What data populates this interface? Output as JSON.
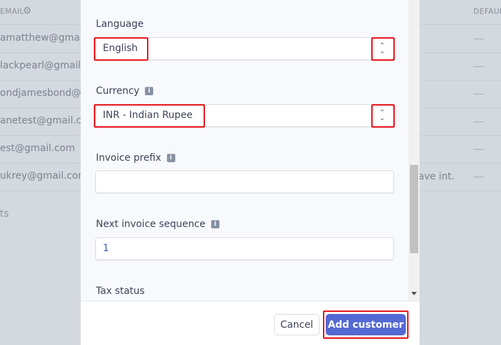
{
  "background": {
    "email_header": "EMAIL",
    "default_header": "DEFAULT",
    "emails": [
      "amatthew@gmail.com",
      "lackpearl@gmail.com",
      "ondjamesbond@gmail.com",
      "anetest@gmail.com",
      "est@gmail.com",
      "ukrey@gmail.com"
    ],
    "row6_extra": "ave int.",
    "dash": "—",
    "footer_text": "ts"
  },
  "modal": {
    "language": {
      "label": "Language",
      "value": "English"
    },
    "currency": {
      "label": "Currency",
      "value": "INR - Indian Rupee"
    },
    "invoice_prefix": {
      "label": "Invoice prefix",
      "value": ""
    },
    "next_invoice_sequence": {
      "label": "Next invoice sequence",
      "value": "1"
    },
    "tax_status": {
      "label": "Tax status"
    },
    "cancel": "Cancel",
    "add_customer": "Add customer"
  },
  "colors": {
    "primary": "#5469d4",
    "highlight": "#e8121b"
  }
}
